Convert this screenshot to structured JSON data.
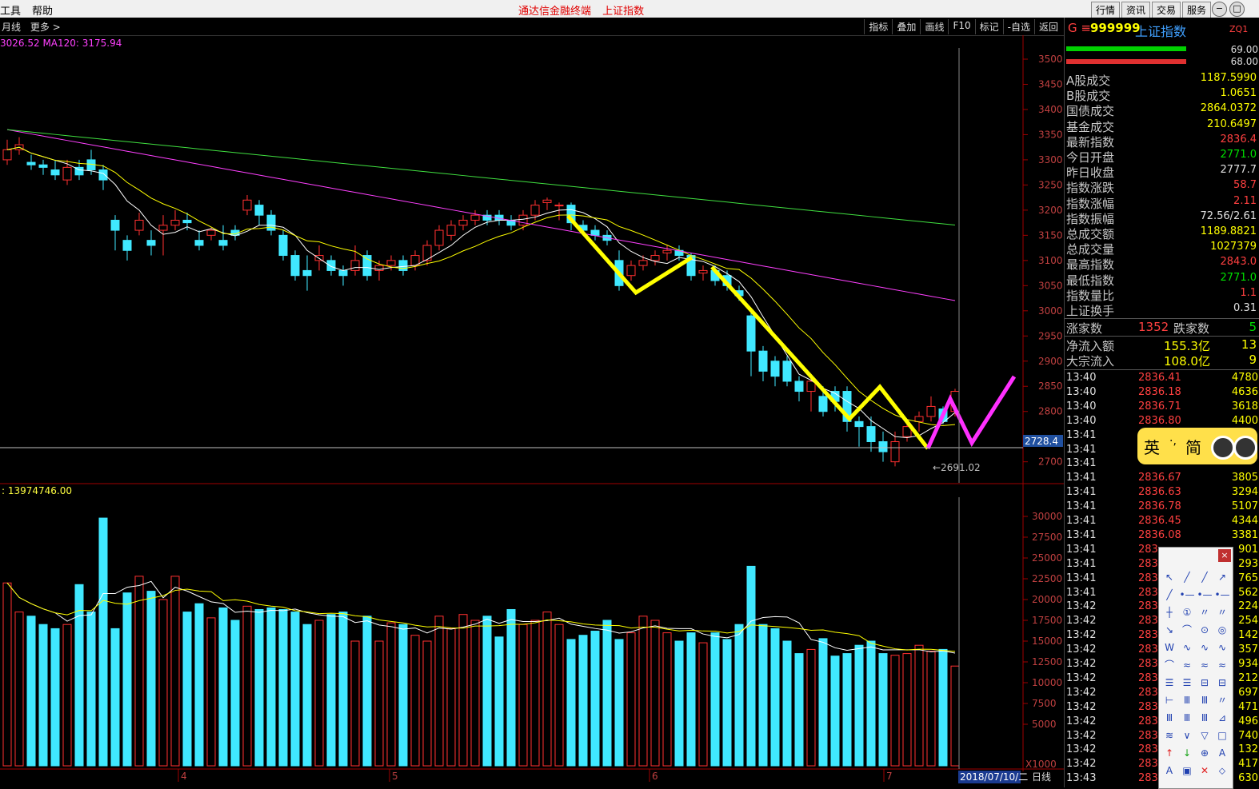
{
  "menu": {
    "items": [
      "工具",
      "帮助"
    ],
    "title": [
      "通达信金融终端",
      "上证指数"
    ],
    "buttons": [
      "行情",
      "资讯",
      "交易",
      "服务"
    ]
  },
  "toolbar": {
    "period": "月线",
    "more": "更多 >",
    "buttons": [
      "指标",
      "叠加",
      "画线",
      "F10",
      "标记",
      "-自选",
      "返回"
    ]
  },
  "chart": {
    "ma_label": "3026.52  MA120: 3175.94",
    "vol_label": ": 13974746.00",
    "price_axis": [
      "3500",
      "3450",
      "3400",
      "3350",
      "3300",
      "3250",
      "3200",
      "3150",
      "3100",
      "3050",
      "3000",
      "2950",
      "2900",
      "2850",
      "2800",
      "2700"
    ],
    "current_price_tag": "2728.4",
    "low_marker": "←2691.02",
    "vol_axis": [
      "30000",
      "27500",
      "25000",
      "22500",
      "20000",
      "17500",
      "15000",
      "12500",
      "10000",
      "7500",
      "5000"
    ],
    "vol_unit": "X1000",
    "months": [
      "4",
      "5",
      "6",
      "7"
    ],
    "date_label": "2018/07/10/二",
    "period_label": "日线"
  },
  "panel": {
    "code": "999999",
    "name": "上证指数",
    "tag": "ZQ1",
    "bar_vals": [
      "69.00",
      "68.00"
    ],
    "rows": [
      {
        "label": "A股成交",
        "value": "1187.5990",
        "color": "yellow"
      },
      {
        "label": "B股成交",
        "value": "1.0651",
        "color": "yellow"
      },
      {
        "label": "国债成交",
        "value": "2864.0372",
        "color": "yellow"
      },
      {
        "label": "基金成交",
        "value": "210.6497",
        "color": "yellow"
      },
      {
        "label": "最新指数",
        "value": "2836.4",
        "color": "red"
      },
      {
        "label": "今日开盘",
        "value": "2771.0",
        "color": "green"
      },
      {
        "label": "昨日收盘",
        "value": "2777.7",
        "color": "white"
      },
      {
        "label": "指数涨跌",
        "value": "58.7",
        "color": "red"
      },
      {
        "label": "指数涨幅",
        "value": "2.11",
        "color": "red"
      },
      {
        "label": "指数振幅",
        "value": "72.56/2.61",
        "color": "white"
      },
      {
        "label": "总成交额",
        "value": "1189.8821",
        "color": "yellow"
      },
      {
        "label": "总成交量",
        "value": "1027379",
        "color": "yellow"
      },
      {
        "label": "最高指数",
        "value": "2843.0",
        "color": "red"
      },
      {
        "label": "最低指数",
        "value": "2771.0",
        "color": "green"
      },
      {
        "label": "指数量比",
        "value": "1.1",
        "color": "red"
      },
      {
        "label": "上证换手",
        "value": "0.31",
        "color": "white"
      }
    ],
    "rise_label": "涨家数",
    "rise_value": "1352",
    "fall_label": "跌家数",
    "fall_value": "5",
    "flow": [
      {
        "label": "净流入额",
        "value": "155.3亿",
        "extra": "13"
      },
      {
        "label": "大宗流入",
        "value": "108.0亿",
        "extra": "9"
      }
    ],
    "trades": [
      {
        "t": "13:40",
        "p": "2836.41",
        "v": "4780"
      },
      {
        "t": "13:40",
        "p": "2836.18",
        "v": "4636"
      },
      {
        "t": "13:40",
        "p": "2836.71",
        "v": "3618"
      },
      {
        "t": "13:40",
        "p": "2836.80",
        "v": "4400"
      },
      {
        "t": "13:41",
        "p": "",
        "v": ""
      },
      {
        "t": "13:41",
        "p": "",
        "v": ""
      },
      {
        "t": "13:41",
        "p": "",
        "v": ""
      },
      {
        "t": "13:41",
        "p": "2836.67",
        "v": "3805"
      },
      {
        "t": "13:41",
        "p": "2836.63",
        "v": "3294"
      },
      {
        "t": "13:41",
        "p": "2836.78",
        "v": "5107"
      },
      {
        "t": "13:41",
        "p": "2836.45",
        "v": "4344"
      },
      {
        "t": "13:41",
        "p": "2836.08",
        "v": "3381"
      },
      {
        "t": "13:41",
        "p": "283",
        "v": "901"
      },
      {
        "t": "13:41",
        "p": "283",
        "v": "293"
      },
      {
        "t": "13:41",
        "p": "283",
        "v": "765"
      },
      {
        "t": "13:41",
        "p": "283",
        "v": "562"
      },
      {
        "t": "13:42",
        "p": "283",
        "v": "224"
      },
      {
        "t": "13:42",
        "p": "283",
        "v": "254"
      },
      {
        "t": "13:42",
        "p": "283",
        "v": "142"
      },
      {
        "t": "13:42",
        "p": "283",
        "v": "357"
      },
      {
        "t": "13:42",
        "p": "283",
        "v": "934"
      },
      {
        "t": "13:42",
        "p": "283",
        "v": "212"
      },
      {
        "t": "13:42",
        "p": "283",
        "v": "697"
      },
      {
        "t": "13:42",
        "p": "283",
        "v": "471"
      },
      {
        "t": "13:42",
        "p": "283",
        "v": "496"
      },
      {
        "t": "13:42",
        "p": "283",
        "v": "740"
      },
      {
        "t": "13:42",
        "p": "283",
        "v": "132"
      },
      {
        "t": "13:42",
        "p": "283",
        "v": "417"
      },
      {
        "t": "13:43",
        "p": "283",
        "v": "630"
      }
    ]
  },
  "ime": {
    "a": "英",
    "b": "·,",
    "c": "简"
  }
}
